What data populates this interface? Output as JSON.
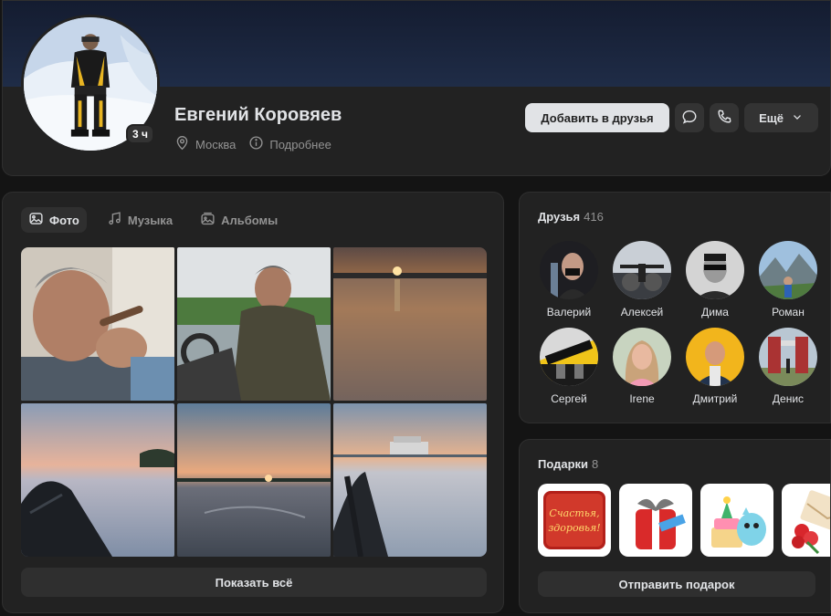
{
  "profile": {
    "name": "Евгений Коровяев",
    "online": "3 ч",
    "city": "Москва",
    "details": "Подробнее",
    "add_friend": "Добавить в друзья",
    "more": "Ещё"
  },
  "media": {
    "tabs": [
      {
        "label": "Фото",
        "icon": "image-icon",
        "active": true
      },
      {
        "label": "Музыка",
        "icon": "music-note-icon",
        "active": false
      },
      {
        "label": "Альбомы",
        "icon": "album-icon",
        "active": false
      }
    ],
    "show_all": "Показать всё"
  },
  "friends": {
    "title": "Друзья",
    "count": "416",
    "items": [
      {
        "name": "Валерий"
      },
      {
        "name": "Алексей"
      },
      {
        "name": "Дима"
      },
      {
        "name": "Роман"
      },
      {
        "name": "Сергей"
      },
      {
        "name": "Irene"
      },
      {
        "name": "Дмитрий"
      },
      {
        "name": "Денис"
      }
    ]
  },
  "gifts": {
    "title": "Подарки",
    "count": "8",
    "send": "Отправить подарок",
    "card_text_1": "Счастья,",
    "card_text_2": "здоровья!"
  },
  "colors": {
    "background": "#141414",
    "card": "#222222",
    "button_secondary": "#333333",
    "button_primary": "#e1e3e6",
    "text_primary": "#e1e3e6",
    "text_secondary": "#939393"
  }
}
